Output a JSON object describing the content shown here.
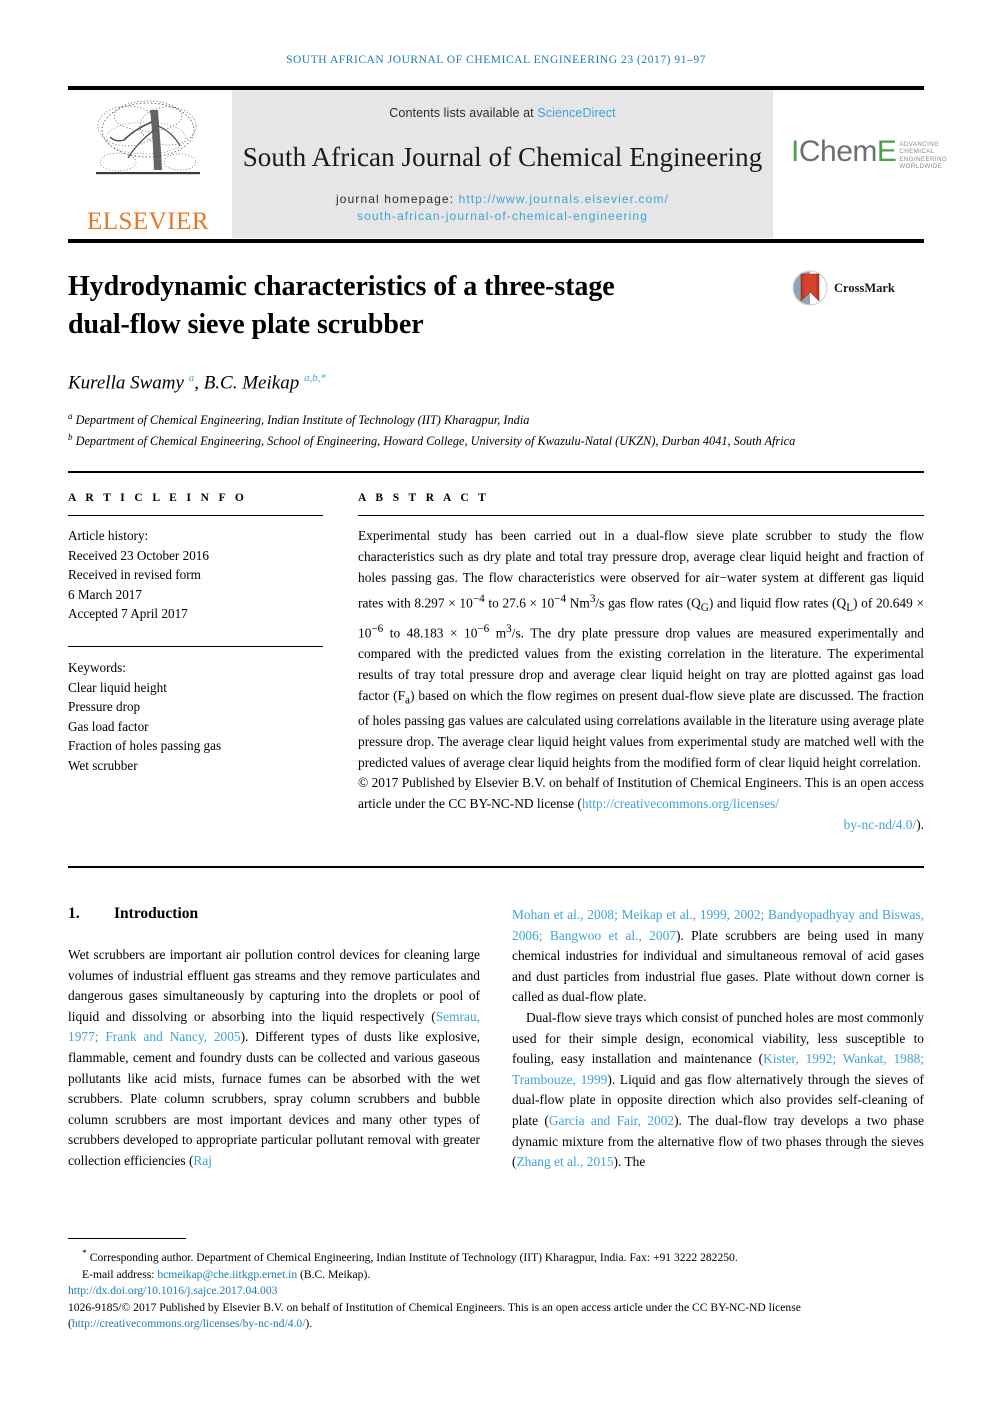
{
  "running_head": "SOUTH AFRICAN JOURNAL OF CHEMICAL ENGINEERING 23 (2017) 91–97",
  "masthead": {
    "publisher_name": "ELSEVIER",
    "publisher_logo_icon": "elsevier-tree-icon",
    "contents_prefix": "Contents lists available at ",
    "contents_link": "ScienceDirect",
    "journal_title": "South African Journal of Chemical Engineering",
    "homepage_prefix": "journal homepage: ",
    "homepage_url_line1": "http://www.journals.elsevier.com/",
    "homepage_url_line2": "south-african-journal-of-chemical-engineering",
    "society_logo_text": "IChemE",
    "society_logo_tagline": "ADVANCING CHEMICAL ENGINEERING WORLDWIDE"
  },
  "article": {
    "title_line1": "Hydrodynamic characteristics of a three-stage",
    "title_line2": "dual-flow sieve plate scrubber",
    "crossmark_label": "CrossMark",
    "authors_html": "Kurella Swamy <sup>a</sup>, B.C. Meikap <sup>a,b,*</sup>",
    "affiliation_a": "Department of Chemical Engineering, Indian Institute of Technology (IIT) Kharagpur, India",
    "affiliation_b": "Department of Chemical Engineering, School of Engineering, Howard College, University of Kwazulu-Natal (UKZN), Durban 4041, South Africa"
  },
  "article_info": {
    "heading": "A R T I C L E  I N F O",
    "history_label": "Article history:",
    "history": [
      "Received 23 October 2016",
      "Received in revised form",
      "6 March 2017",
      "Accepted 7 April 2017"
    ],
    "keywords_label": "Keywords:",
    "keywords": [
      "Clear liquid height",
      "Pressure drop",
      "Gas load factor",
      "Fraction of holes passing gas",
      "Wet scrubber"
    ]
  },
  "abstract": {
    "heading": "A B S T R A C T",
    "body_html": "Experimental study has been carried out in a dual-flow sieve plate scrubber to study the flow characteristics such as dry plate and total tray pressure drop, average clear liquid height and fraction of holes passing gas. The flow characteristics were observed for air&minus;water system at different gas liquid rates with 8.297 &times; 10<sup>&minus;4</sup> to 27.6 &times; 10<sup>&minus;4</sup> Nm<sup>3</sup>/s gas flow rates (Q<sub>G</sub>) and liquid flow rates (Q<sub>L</sub>) of 20.649 &times; 10<sup>&minus;6</sup> to 48.183 &times; 10<sup>&minus;6</sup> m<sup>3</sup>/s. The dry plate pressure drop values are measured experimentally and compared with the predicted values from the existing correlation in the literature. The experimental results of tray total pressure drop and average clear liquid height on tray are plotted against gas load factor (F<sub>a</sub>) based on which the flow regimes on present dual-flow sieve plate are discussed. The fraction of holes passing gas values are calculated using correlations available in the literature using average plate pressure drop. The average clear liquid height values from experimental study are matched well with the predicted values of average clear liquid heights from the modified form of clear liquid height correlation.",
    "copyright_prefix": "© 2017 Published by Elsevier B.V. on behalf of Institution of Chemical Engineers. This is an open access article under the CC BY-NC-ND license (",
    "license_url_line1": "http://creativecommons.org/licenses/",
    "license_url_line2": "by-nc-nd/4.0/",
    "copyright_suffix": ")."
  },
  "introduction": {
    "number": "1.",
    "heading": "Introduction",
    "left_para_html": "Wet scrubbers are important air pollution control devices for cleaning large volumes of industrial effluent gas streams and they remove particulates and dangerous gases simultaneously by capturing into the droplets or pool of liquid and dissolving or absorbing into the liquid respectively (<span class=\"lnk\">Semrau, 1977; Frank and Nancy, 2005</span>). Different types of dusts like explosive, flammable, cement and foundry dusts can be collected and various gaseous pollutants like acid mists, furnace fumes can be absorbed with the wet scrubbers. Plate column scrubbers, spray column scrubbers and bubble column scrubbers are most important devices and many other types of scrubbers developed to appropriate particular pollutant removal with greater collection efficiencies (<span class=\"lnk\">Raj</span>",
    "right_para1_html": "<span class=\"lnk\">Mohan et al., 2008; Meikap et al., 1999, 2002; Bandyopadhyay and Biswas, 2006; Bangwoo et al., 2007</span>). Plate scrubbers are being used in many chemical industries for individual and simultaneous removal of acid gases and dust particles from industrial flue gases. Plate without down corner is called as dual-flow plate.",
    "right_para2_html": "Dual-flow sieve trays which consist of punched holes are most commonly used for their simple design, economical viability, less susceptible to fouling, easy installation and maintenance (<span class=\"lnk\">Kister, 1992; Wankat, 1988; Trambouze, 1999</span>). Liquid and gas flow alternatively through the sieves of dual-flow plate in opposite direction which also provides self-cleaning of plate (<span class=\"lnk\">Garcia and Fair, 2002</span>). The dual-flow tray develops a two phase dynamic mixture from the alternative flow of two phases through the sieves (<span class=\"lnk\">Zhang et al., 2015</span>). The"
  },
  "footnote": {
    "corresponding_html": "<sup>*</sup> Corresponding author. Department of Chemical Engineering, Indian Institute of Technology (IIT) Kharagpur, India. Fax: +91 3222 282250.",
    "email_prefix": "E-mail address: ",
    "email": "bcmeikap@che.iitkgp.ernet.in",
    "email_suffix": " (B.C. Meikap).",
    "doi": "http://dx.doi.org/10.1016/j.sajce.2017.04.003",
    "license_line_prefix": "1026-9185/© 2017 Published by Elsevier B.V. on behalf of Institution of Chemical Engineers. This is an open access article under the CC BY-NC-ND license (",
    "license_line_url": "http://creativecommons.org/licenses/by-nc-nd/4.0/",
    "license_line_suffix": ")."
  },
  "colors": {
    "link": "#3da3d8",
    "running_head": "#1a7cb5",
    "elsevier_orange": "#E87722",
    "icheme_green": "#4f9e4f",
    "gray_panel": "#e6e6e6"
  }
}
